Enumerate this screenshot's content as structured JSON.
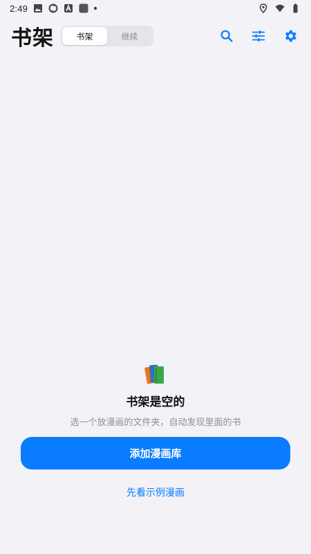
{
  "status_bar": {
    "time": "2:49",
    "left_icons": [
      "gallery-icon",
      "sync-icon",
      "font-a-icon",
      "app-square-icon",
      "dot-icon"
    ],
    "right_icons": [
      "location-pin-icon",
      "wifi-icon",
      "battery-icon"
    ]
  },
  "header": {
    "title": "书架",
    "tabs": [
      {
        "label": "书架",
        "active": true
      },
      {
        "label": "继续",
        "active": false
      }
    ],
    "actions": [
      "search-icon",
      "filter-sliders-icon",
      "gear-icon"
    ]
  },
  "empty_state": {
    "icon": "books-icon",
    "title": "书架是空的",
    "subtitle": "选一个放漫画的文件夹，自动发现里面的书",
    "primary_button": "添加漫画库",
    "secondary_link": "先看示例漫画"
  },
  "colors": {
    "accent": "#0a7cff",
    "background": "#f2f2f7",
    "segment_bg": "#e4e4ea",
    "muted_text": "#8e8e93"
  }
}
